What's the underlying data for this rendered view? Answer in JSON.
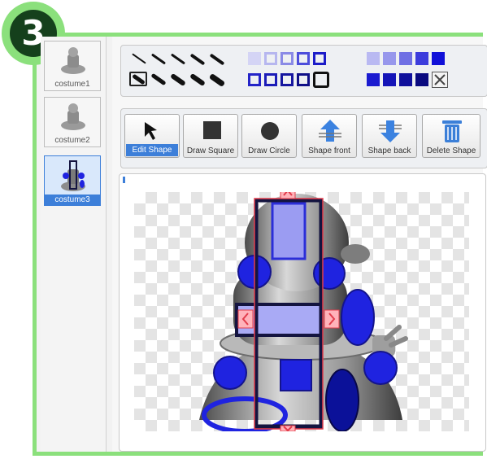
{
  "step_badge": {
    "number": "3"
  },
  "costumes": [
    {
      "label": "costume1",
      "selected": false
    },
    {
      "label": "costume2",
      "selected": false
    },
    {
      "label": "costume3",
      "selected": true
    }
  ],
  "palette": {
    "pen_sizes_row1": 5,
    "pen_sizes_row2": 5,
    "outline_colors": [
      "#c9c9f2",
      "#9a9ae9",
      "#5b5bdd",
      "#2020c8",
      "#000080"
    ],
    "fill_colors": [
      "#a6a6f0",
      "#7b7be8",
      "#4b4be0",
      "#1f1fd0",
      "#0a0a80"
    ],
    "no_fill_icon": "close-icon"
  },
  "tools": [
    {
      "label": "Edit Shape",
      "icon": "cursor-arrow-icon",
      "selected": true
    },
    {
      "label": "Draw Square",
      "icon": "square-icon",
      "selected": false
    },
    {
      "label": "Draw Circle",
      "icon": "circle-icon",
      "selected": false
    },
    {
      "label": "Shape front",
      "icon": "arrow-up-icon",
      "selected": false
    },
    {
      "label": "Shape back",
      "icon": "arrow-down-icon",
      "selected": false
    },
    {
      "label": "Delete Shape",
      "icon": "trash-icon",
      "selected": false
    }
  ],
  "colors": {
    "frame_green": "#8be07c",
    "badge_dark": "#15401c",
    "selection_red": "#e23c4b",
    "shape_blue": "#1f23e0",
    "shape_light": "#a9aaf5",
    "outline_dark": "#141440"
  }
}
